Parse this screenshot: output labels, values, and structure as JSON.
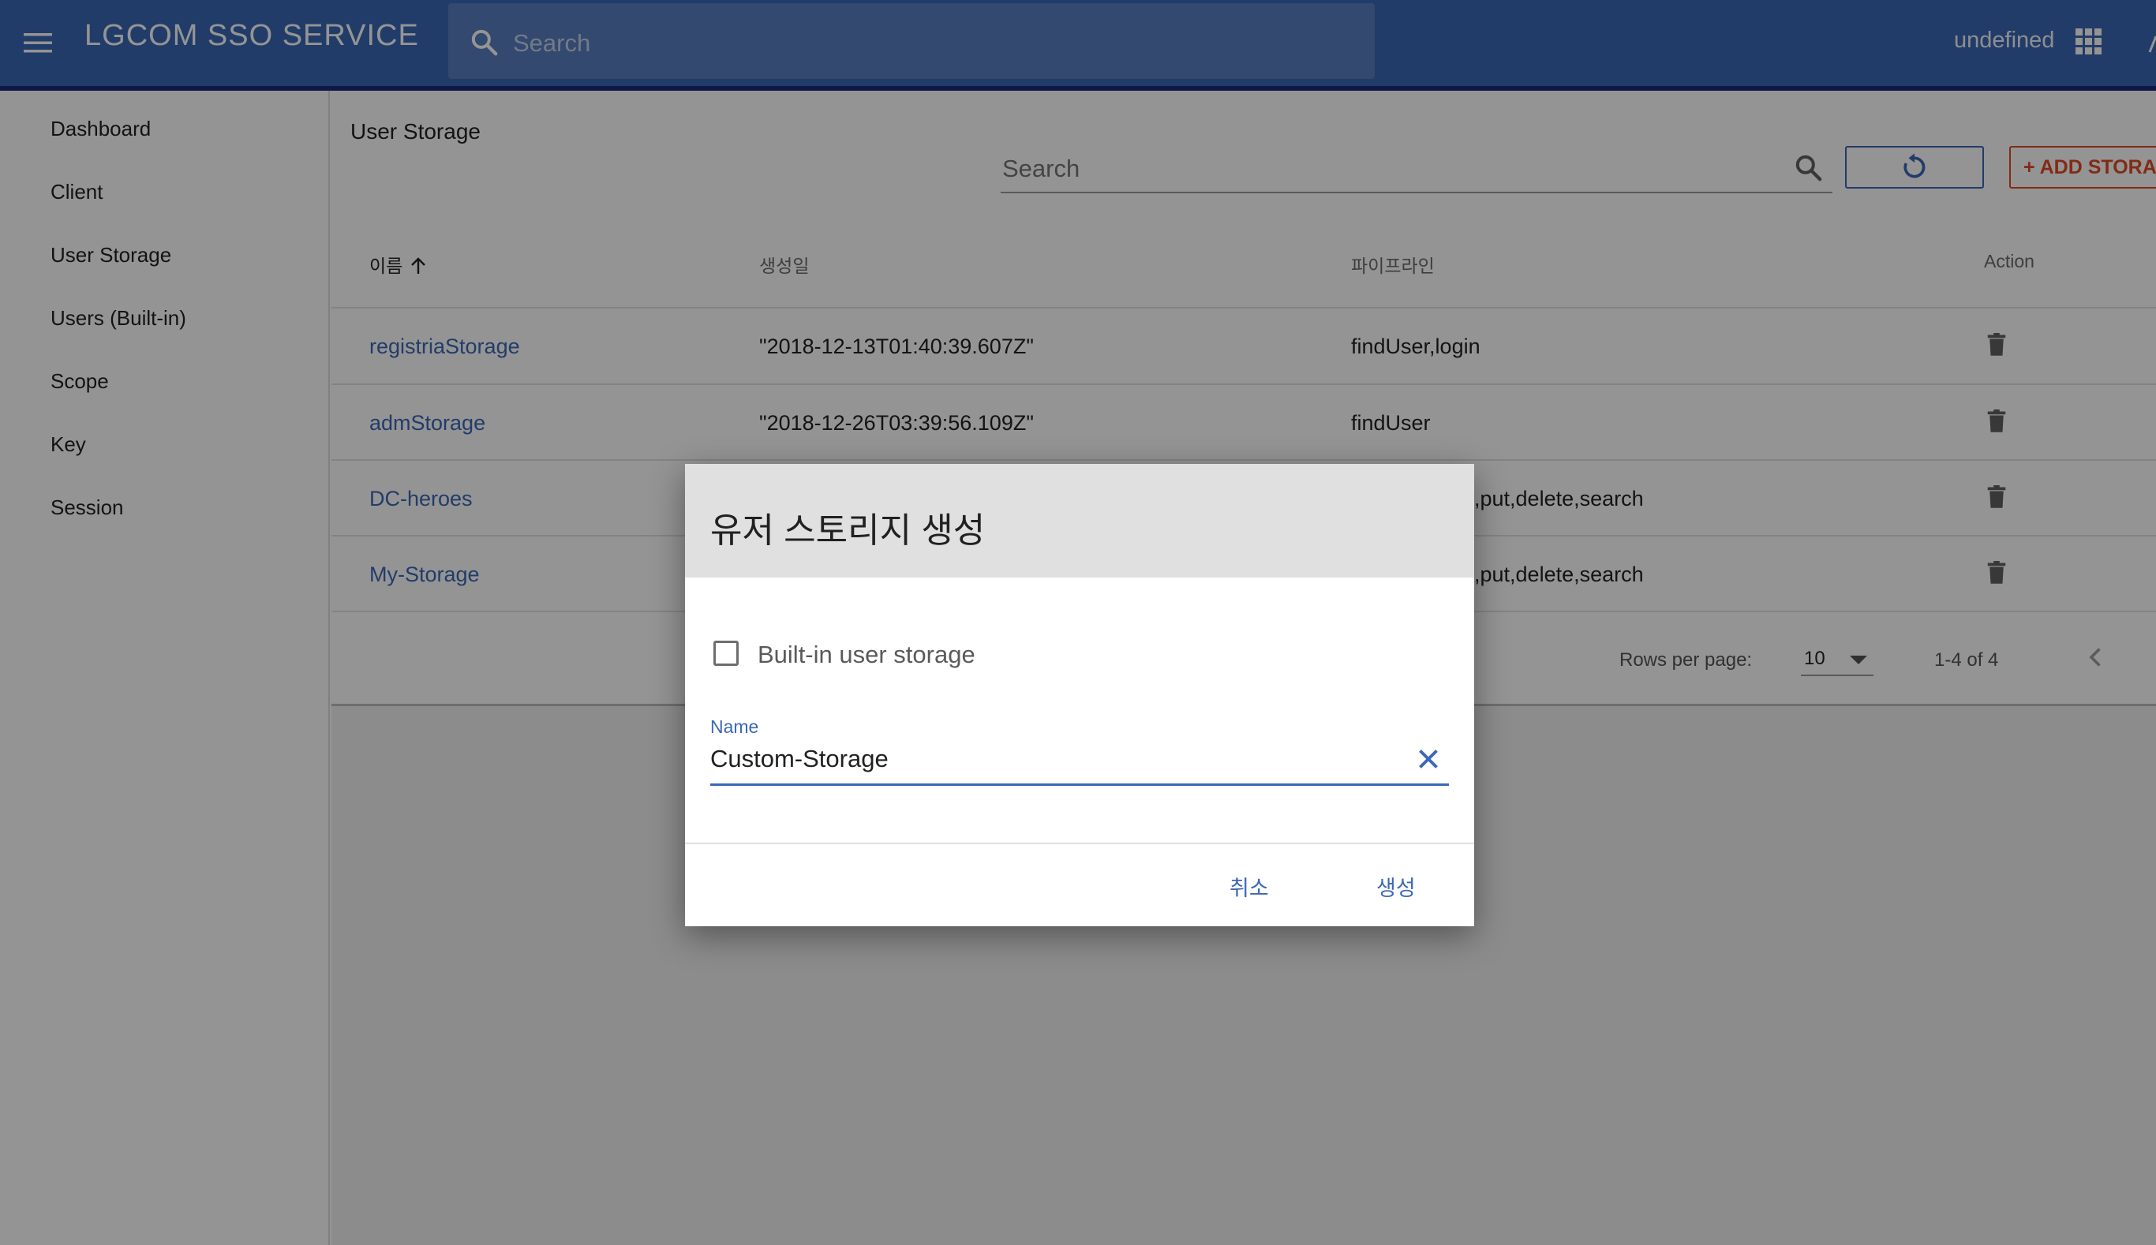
{
  "appbar": {
    "title": "LGCOM SSO SERVICE",
    "search_placeholder": "Search",
    "user_label": "undefined",
    "bar_color": "#3b68b5"
  },
  "sidebar": {
    "items": [
      {
        "label": "Dashboard"
      },
      {
        "label": "Client"
      },
      {
        "label": "User Storage"
      },
      {
        "label": "Users (Built-in)"
      },
      {
        "label": "Scope"
      },
      {
        "label": "Key"
      },
      {
        "label": "Session"
      }
    ]
  },
  "page": {
    "title": "User Storage",
    "search_placeholder": "Search",
    "add_button_label": "+ ADD STORAGE"
  },
  "table": {
    "columns": [
      "이름",
      "생성일",
      "파이프라인",
      "Action"
    ],
    "sorted_column": "이름",
    "sort_direction": "asc",
    "rows": [
      {
        "name": "registriaStorage",
        "created": "\"2018-12-13T01:40:39.607Z\"",
        "pipeline": "findUser,login"
      },
      {
        "name": "admStorage",
        "created": "\"2018-12-26T03:39:56.109Z\"",
        "pipeline": "findUser"
      },
      {
        "name": "DC-heroes",
        "created": "",
        "pipeline": ",put,delete,search"
      },
      {
        "name": "My-Storage",
        "created": "",
        "pipeline": ",put,delete,search"
      }
    ],
    "row_action_icon": "delete-icon"
  },
  "pagination": {
    "rows_per_page_label": "Rows per page:",
    "rows_per_page_value": "10",
    "range": "1-4 of 4"
  },
  "dialog": {
    "title": "유저 스토리지 생성",
    "checkbox_label": "Built-in user storage",
    "checkbox_checked": false,
    "name_label": "Name",
    "name_value": "Custom-Storage",
    "cancel_label": "취소",
    "create_label": "생성",
    "accent_color": "#3b68b5"
  }
}
